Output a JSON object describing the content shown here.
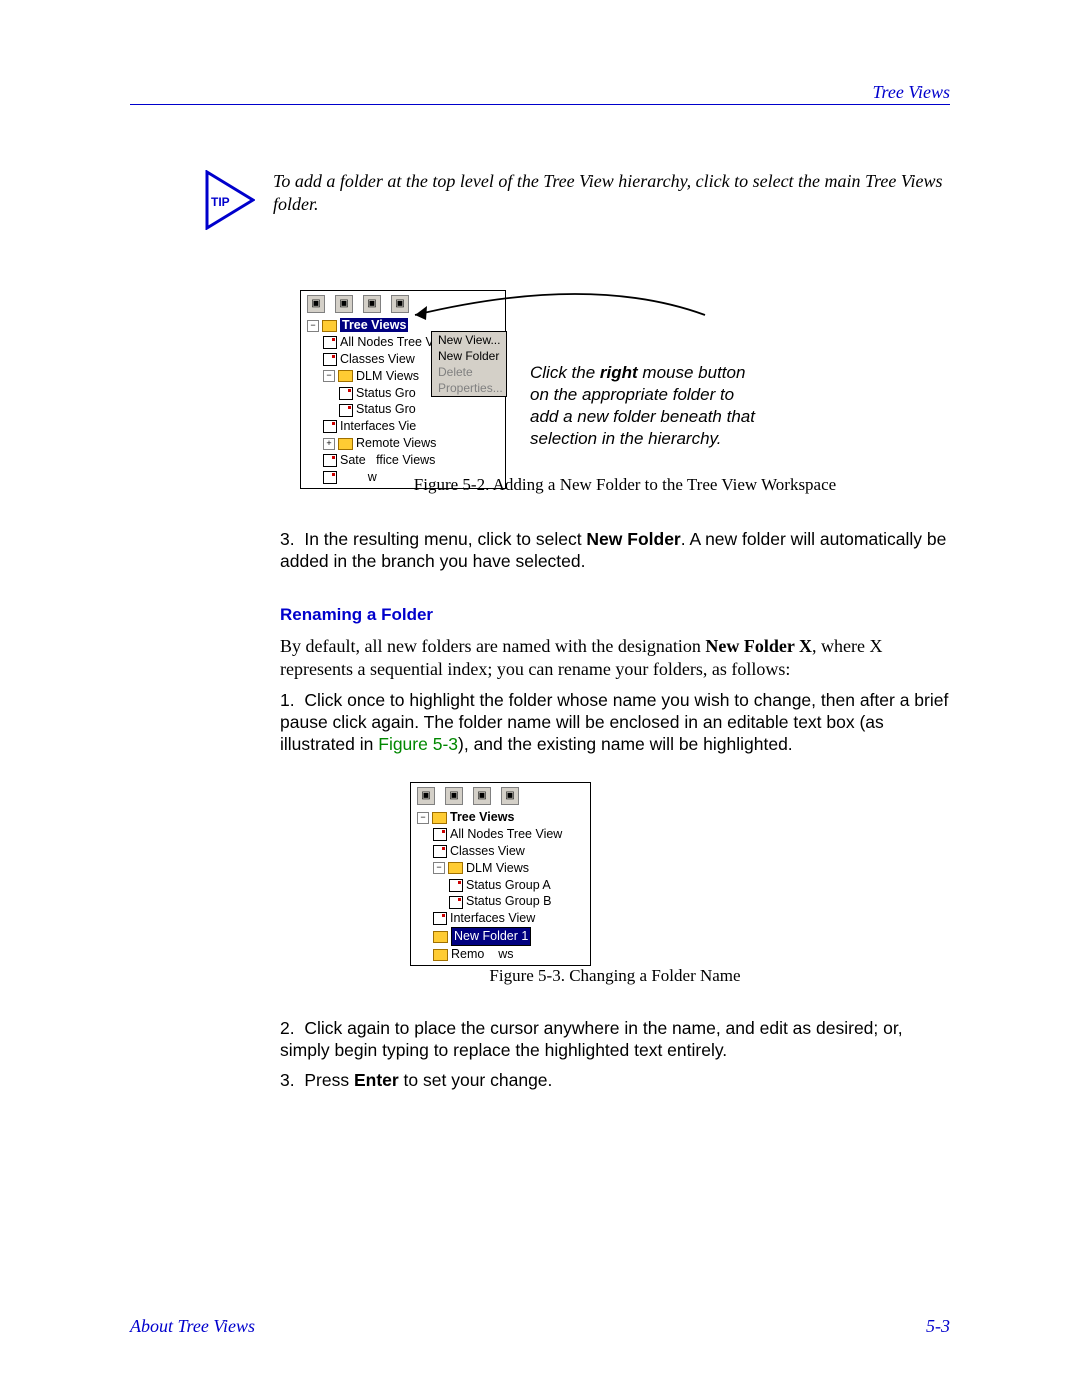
{
  "header": {
    "right": "Tree Views"
  },
  "tip": {
    "label": "TIP",
    "text": "To add a folder at the top level of the Tree View hierarchy, click to select the main Tree Views folder."
  },
  "figure1": {
    "toolbar_count": 4,
    "tree": {
      "root": "Tree Views",
      "items": [
        "All Nodes Tree View",
        "Classes View"
      ],
      "dlm": {
        "label": "DLM Views",
        "children": [
          "Status Gro",
          "Status Gro"
        ]
      },
      "interfaces": "Interfaces Vie",
      "remote": "Remote Views",
      "satellite_a": "Sate",
      "satellite_b": "ffice Views",
      "cursor_frag": "w"
    },
    "menu": {
      "items": [
        {
          "label": "New View...",
          "disabled": false
        },
        {
          "label": "New Folder",
          "disabled": false
        },
        {
          "label": "Delete",
          "disabled": true
        },
        {
          "label": "Properties...",
          "disabled": true
        }
      ]
    },
    "callout_pre": "Click the ",
    "callout_bold": "right",
    "callout_post": " mouse button on the appropriate folder to add a new folder beneath that selection in the hierarchy.",
    "caption": "Figure 5-2. Adding a New Folder to the Tree View Workspace"
  },
  "step3": {
    "num": "3.",
    "pre": "In the resulting menu, click to select ",
    "bold": "New Folder",
    "post": ". A new folder will automatically be added in the branch you have selected."
  },
  "rename": {
    "heading": "Renaming a Folder",
    "para_pre": "By default, all new folders are named with the designation ",
    "para_bold": "New Folder X",
    "para_post": ", where X represents a sequential index; you can rename your folders, as follows:",
    "step1": {
      "num": "1.",
      "pre": "Click once to highlight the folder whose name you wish to change, then after a brief pause click again. The folder name will be enclosed in an editable text box (as illustrated in ",
      "ref": "Figure 5-3",
      "post": "), and the existing name will be highlighted."
    },
    "step2": {
      "num": "2.",
      "text": "Click again to place the cursor anywhere in the name, and edit as desired; or, simply begin typing to replace the highlighted text entirely."
    },
    "step3": {
      "num": "3.",
      "pre": "Press ",
      "bold": "Enter",
      "post": " to set your change."
    }
  },
  "figure2": {
    "tree": {
      "root": "Tree Views",
      "items": [
        "All Nodes Tree View",
        "Classes View"
      ],
      "dlm": {
        "label": "DLM Views",
        "children": [
          "Status Group A",
          "Status Group B"
        ]
      },
      "interfaces": "Interfaces View",
      "edit": "New Folder 1",
      "remote_a": "Remo",
      "remote_b": "ws"
    },
    "caption": "Figure 5-3. Changing a Folder Name"
  },
  "footer": {
    "left": "About Tree Views",
    "right": "5-3"
  }
}
